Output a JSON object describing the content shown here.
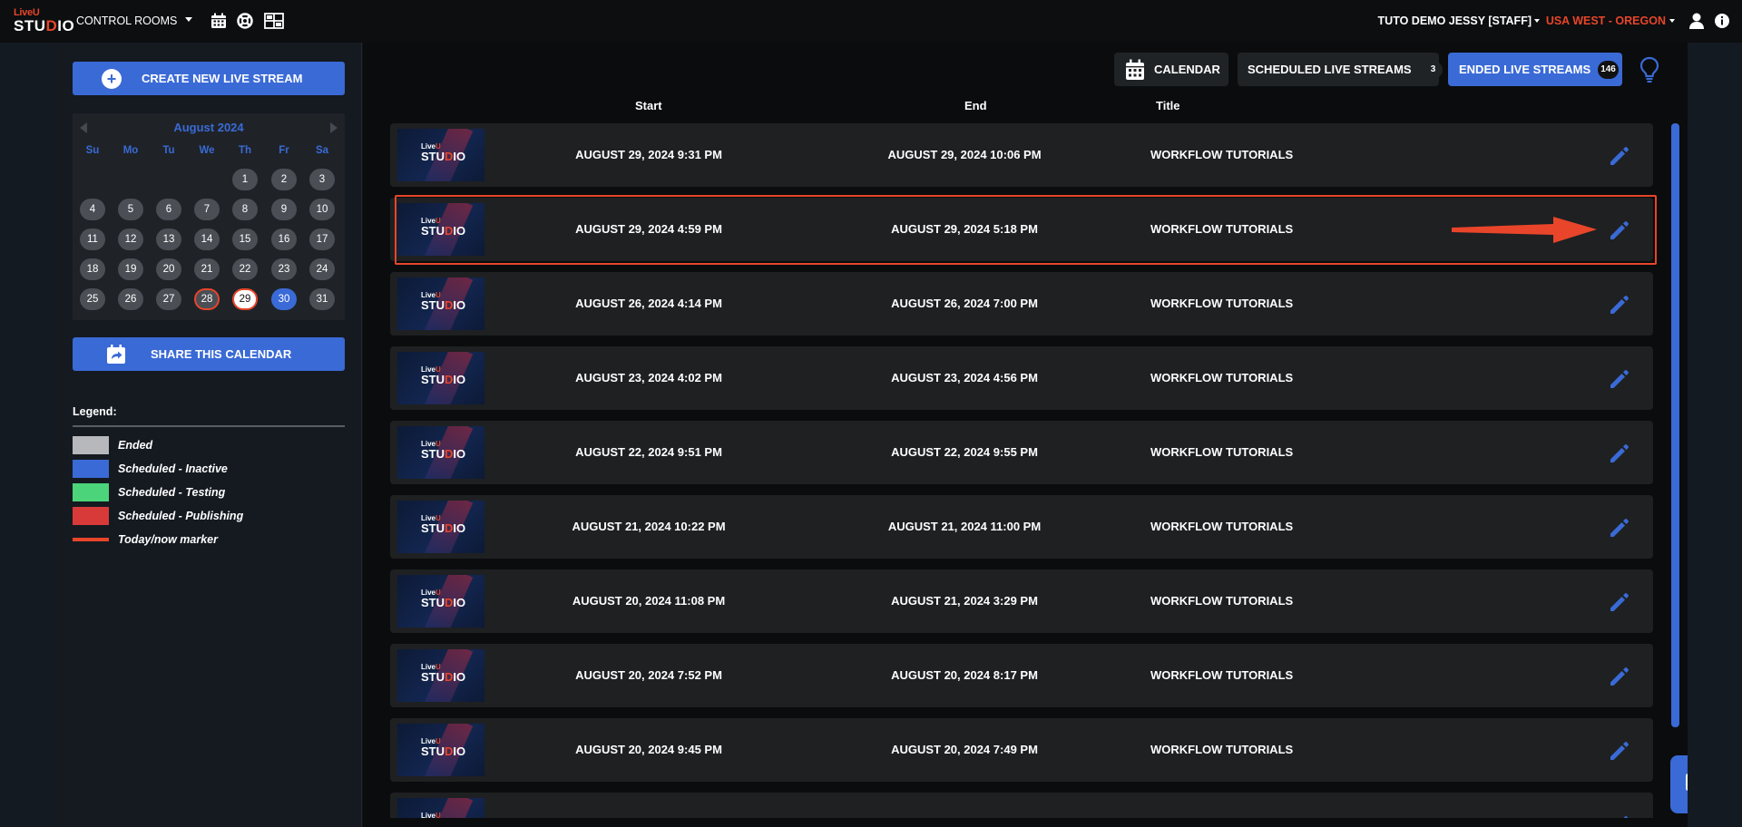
{
  "app": {
    "logo_top": "Live",
    "logo_top_accent": "U",
    "logo_main_pre": "STU",
    "logo_main_accent": "D",
    "logo_main_post": "IO"
  },
  "topbar": {
    "control_rooms_label": "CONTROL ROOMS",
    "icons": [
      "calendar-icon",
      "lifebuoy-icon",
      "layout-icon"
    ],
    "user_label": "TUTO DEMO JESSY [STAFF]",
    "region_label": "USA WEST - OREGON",
    "region_color": "#e8452a"
  },
  "sidebar": {
    "create_button": "CREATE NEW LIVE STREAM",
    "calendar": {
      "month": "August 2024",
      "weekdays": [
        "Su",
        "Mo",
        "Tu",
        "We",
        "Th",
        "Fr",
        "Sa"
      ],
      "days": [
        "1",
        "2",
        "3",
        "4",
        "5",
        "6",
        "7",
        "8",
        "9",
        "10",
        "11",
        "12",
        "13",
        "14",
        "15",
        "16",
        "17",
        "18",
        "19",
        "20",
        "21",
        "22",
        "23",
        "24",
        "25",
        "26",
        "27",
        "28",
        "29",
        "30",
        "31"
      ],
      "first_weekday_index": 4,
      "today": "29",
      "marked_days": [
        "28",
        "29"
      ],
      "scheduled_days": [
        "30"
      ]
    },
    "share_button": "SHARE THIS CALENDAR",
    "legend_title": "Legend:",
    "legend": [
      {
        "label": "Ended",
        "color": "#b7b8bb"
      },
      {
        "label": "Scheduled - Inactive",
        "color": "#3a6ad6"
      },
      {
        "label": "Scheduled - Testing",
        "color": "#4cd47a"
      },
      {
        "label": "Scheduled - Publishing",
        "color": "#d83a3a"
      },
      {
        "label": "Today/now marker",
        "color": "#e8452a"
      }
    ]
  },
  "toolbar": {
    "calendar_label": "CALENDAR",
    "scheduled_label": "SCHEDULED LIVE STREAMS",
    "scheduled_count": "3",
    "ended_label": "ENDED LIVE STREAMS",
    "ended_count": "146"
  },
  "table": {
    "columns": [
      "Start",
      "End",
      "Title"
    ],
    "rows": [
      {
        "start": "AUGUST 29, 2024 9:31 PM",
        "end": "AUGUST 29, 2024 10:06 PM",
        "title": "WORKFLOW TUTORIALS"
      },
      {
        "start": "AUGUST 29, 2024 4:59 PM",
        "end": "AUGUST 29, 2024 5:18 PM",
        "title": "WORKFLOW TUTORIALS"
      },
      {
        "start": "AUGUST 26, 2024 4:14 PM",
        "end": "AUGUST 26, 2024 7:00 PM",
        "title": "WORKFLOW TUTORIALS"
      },
      {
        "start": "AUGUST 23, 2024 4:02 PM",
        "end": "AUGUST 23, 2024 4:56 PM",
        "title": "WORKFLOW TUTORIALS"
      },
      {
        "start": "AUGUST 22, 2024 9:51 PM",
        "end": "AUGUST 22, 2024 9:55 PM",
        "title": "WORKFLOW TUTORIALS"
      },
      {
        "start": "AUGUST 21, 2024 10:22 PM",
        "end": "AUGUST 21, 2024 11:00 PM",
        "title": "WORKFLOW TUTORIALS"
      },
      {
        "start": "AUGUST 20, 2024 11:08 PM",
        "end": "AUGUST 21, 2024 3:29 PM",
        "title": "WORKFLOW TUTORIALS"
      },
      {
        "start": "AUGUST 20, 2024 7:52 PM",
        "end": "AUGUST 20, 2024 8:17 PM",
        "title": "WORKFLOW TUTORIALS"
      },
      {
        "start": "AUGUST 20, 2024 9:45 PM",
        "end": "AUGUST 20, 2024 7:49 PM",
        "title": "WORKFLOW TUTORIALS"
      },
      {
        "start": "",
        "end": "",
        "title": ""
      }
    ],
    "highlighted_row": 1,
    "accent_color": "#3a6ad6",
    "annotation_color": "#e8452a"
  }
}
